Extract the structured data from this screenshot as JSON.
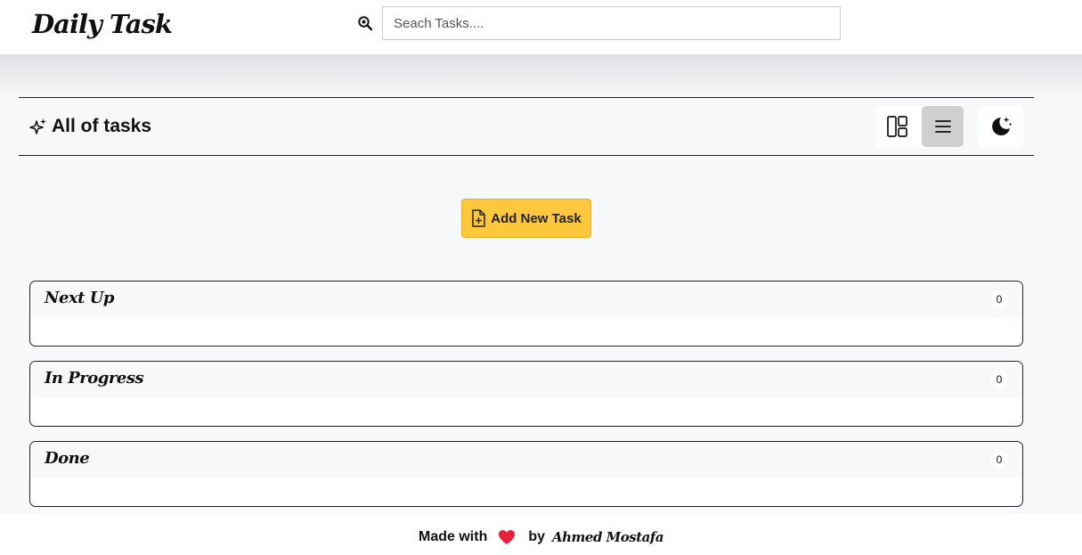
{
  "app": {
    "logo_text": "Daily Task"
  },
  "search": {
    "placeholder": "Seach Tasks...."
  },
  "section": {
    "title": "All of tasks"
  },
  "icons": {
    "search": "search-icon",
    "section": "sparkles-icon",
    "grid_view": "grid-layout-icon",
    "list_view": "list-icon",
    "theme": "moon-stars-icon",
    "add": "file-plus-icon",
    "heart": "heart-icon"
  },
  "view_toggle": {
    "active": "list"
  },
  "actions": {
    "add_task_label": "Add New Task"
  },
  "columns": [
    {
      "title": "Next Up",
      "count": "0"
    },
    {
      "title": "In Progress",
      "count": "0"
    },
    {
      "title": "Done",
      "count": "0"
    }
  ],
  "footer": {
    "made_with": "Made with",
    "by": "by",
    "author": "Ahmed Mostafa"
  },
  "colors": {
    "accent_yellow": "#fec73c",
    "heart_red": "#e8203a",
    "active_toggle": "#cfcfcf",
    "page_bg": "#f7f8fa"
  }
}
